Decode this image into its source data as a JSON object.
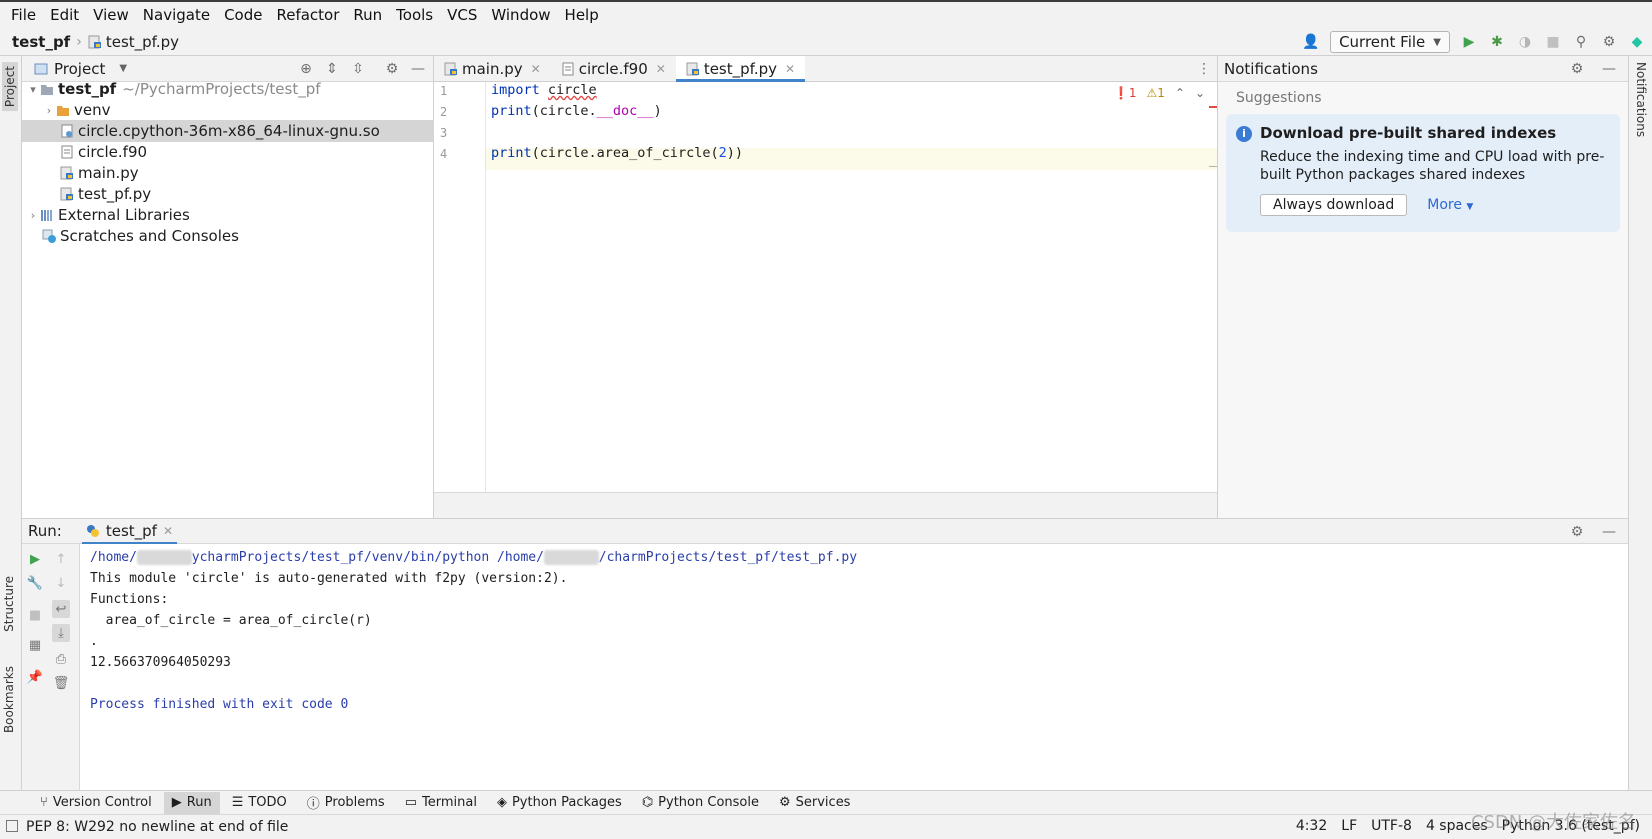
{
  "menu": [
    "File",
    "Edit",
    "View",
    "Navigate",
    "Code",
    "Refactor",
    "Run",
    "Tools",
    "VCS",
    "Window",
    "Help"
  ],
  "nav": {
    "project": "test_pf",
    "file": "test_pf.py",
    "run_config": "Current File"
  },
  "project_panel": {
    "title": "Project",
    "root_name": "test_pf",
    "root_path": "~/PycharmProjects/test_pf",
    "items": [
      "venv",
      "circle.cpython-36m-x86_64-linux-gnu.so",
      "circle.f90",
      "main.py",
      "test_pf.py"
    ],
    "external": "External Libraries",
    "scratches": "Scratches and Consoles"
  },
  "editor": {
    "tabs": [
      "main.py",
      "circle.f90",
      "test_pf.py"
    ],
    "active_tab": "test_pf.py",
    "line_numbers": [
      "1",
      "2",
      "3",
      "4"
    ],
    "lines": {
      "l1_kw": "import",
      "l1_mod": "circle",
      "l2_fn": "print",
      "l2_open": "(circle.",
      "l2_dunder": "__doc__",
      "l2_close": ")",
      "l4_fn": "print",
      "l4_mid": "(circle.area_of_circle(",
      "l4_num": "2",
      "l4_close": "))"
    },
    "errors": "1",
    "warnings": "1"
  },
  "notifications": {
    "title": "Notifications",
    "section": "Suggestions",
    "card_title": "Download pre-built shared indexes",
    "card_body": "Reduce the indexing time and CPU load with pre-built Python packages shared indexes",
    "button": "Always download",
    "more": "More"
  },
  "run": {
    "label": "Run:",
    "tab": "test_pf",
    "console": {
      "path_start": "/home/",
      "path_mid": "ycharmProjects/test_pf/venv/bin/python /home/",
      "path_end": "/charmProjects/test_pf/test_pf.py",
      "l2": "This module 'circle' is auto-generated with f2py (version:2).",
      "l3": "Functions:",
      "l4": "  area_of_circle = area_of_circle(r)",
      "l5": ".",
      "l6": "12.566370964050293",
      "l8": "Process finished with exit code 0"
    }
  },
  "bottom_tools": [
    "Version Control",
    "Run",
    "TODO",
    "Problems",
    "Terminal",
    "Python Packages",
    "Python Console",
    "Services"
  ],
  "side_tabs": {
    "project": "Project",
    "structure": "Structure",
    "bookmarks": "Bookmarks",
    "notifications": "Notifications"
  },
  "status": {
    "message": "PEP 8: W292 no newline at end of file",
    "position": "4:32",
    "line_sep": "LF",
    "encoding": "UTF-8",
    "indent": "4 spaces",
    "interpreter": "Python 3.6 (test_pf)"
  },
  "watermark": "CSDN @大佐家佐名",
  "colors": {
    "accent": "#4083c9",
    "keyword": "#0033b3",
    "dunder": "#b200b2",
    "console_path": "#2a3eab"
  }
}
